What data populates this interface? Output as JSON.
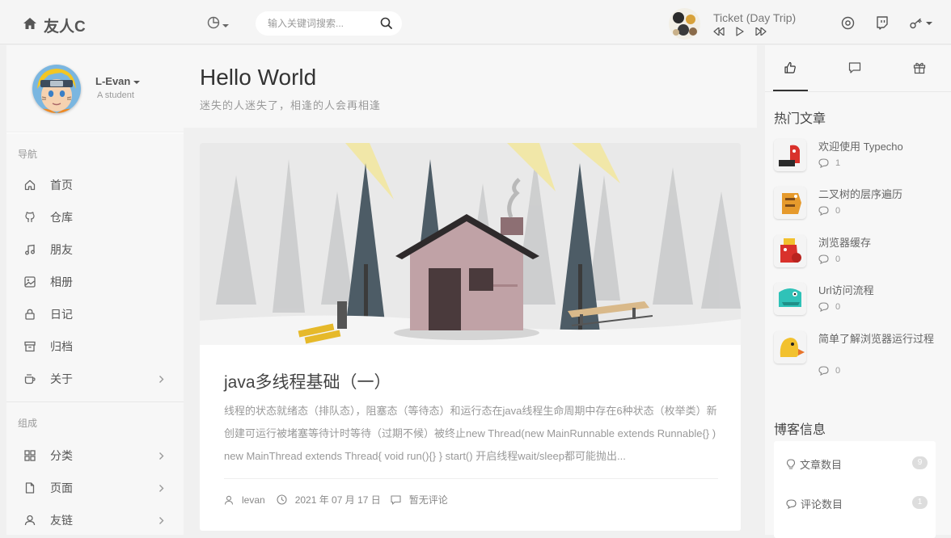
{
  "topbar": {
    "brand": "友人C",
    "search_placeholder": "输入关键词搜索...",
    "player": {
      "track": "Ticket (Day Trip)"
    }
  },
  "sidebar": {
    "user": {
      "name": "L-Evan",
      "title": "A student"
    },
    "nav_label": "导航",
    "nav": [
      {
        "label": "首页",
        "icon": "home-icon"
      },
      {
        "label": "仓库",
        "icon": "github-icon"
      },
      {
        "label": "朋友",
        "icon": "music-icon"
      },
      {
        "label": "相册",
        "icon": "image-icon"
      },
      {
        "label": "日记",
        "icon": "lock-icon"
      },
      {
        "label": "归档",
        "icon": "archive-icon"
      },
      {
        "label": "关于",
        "icon": "coffee-icon"
      }
    ],
    "group_label": "组成",
    "group": [
      {
        "label": "分类",
        "icon": "grid-icon"
      },
      {
        "label": "页面",
        "icon": "file-icon"
      },
      {
        "label": "友链",
        "icon": "user-icon"
      }
    ]
  },
  "main": {
    "title": "Hello World",
    "subtitle": "迷失的人迷失了，相逢的人会再相逢",
    "post": {
      "title": "java多线程基础（一）",
      "excerpt": "线程的状态就绪态（排队态），阻塞态（等待态）和运行态在java线程生命周期中存在6种状态（枚举类）新创建可运行被堵塞等待计时等待（过期不候）被终止new Thread(new MainRunnable extends Runnable{} ) new MainThread extends Thread{ void run(){} } start() 开启线程wait/sleep都可能抛出...",
      "author": "levan",
      "date": "2021 年 07 月 17 日",
      "comments": "暂无评论"
    }
  },
  "aside": {
    "hot_heading": "热门文章",
    "hot": [
      {
        "title": "欢迎使用 Typecho",
        "count": "1",
        "color": "#d9312b"
      },
      {
        "title": "二叉树的层序遍历",
        "count": "0",
        "color": "#e69a2c"
      },
      {
        "title": "浏览器缓存",
        "count": "0",
        "color": "#d9312b"
      },
      {
        "title": "Url访问流程",
        "count": "0",
        "color": "#2fc2b8"
      },
      {
        "title": "简单了解浏览器运行过程",
        "count": "0",
        "color": "#f2c12e"
      }
    ],
    "info_heading": "博客信息",
    "info": [
      {
        "label": "文章数目",
        "value": "9"
      },
      {
        "label": "评论数目",
        "value": "1"
      }
    ]
  }
}
